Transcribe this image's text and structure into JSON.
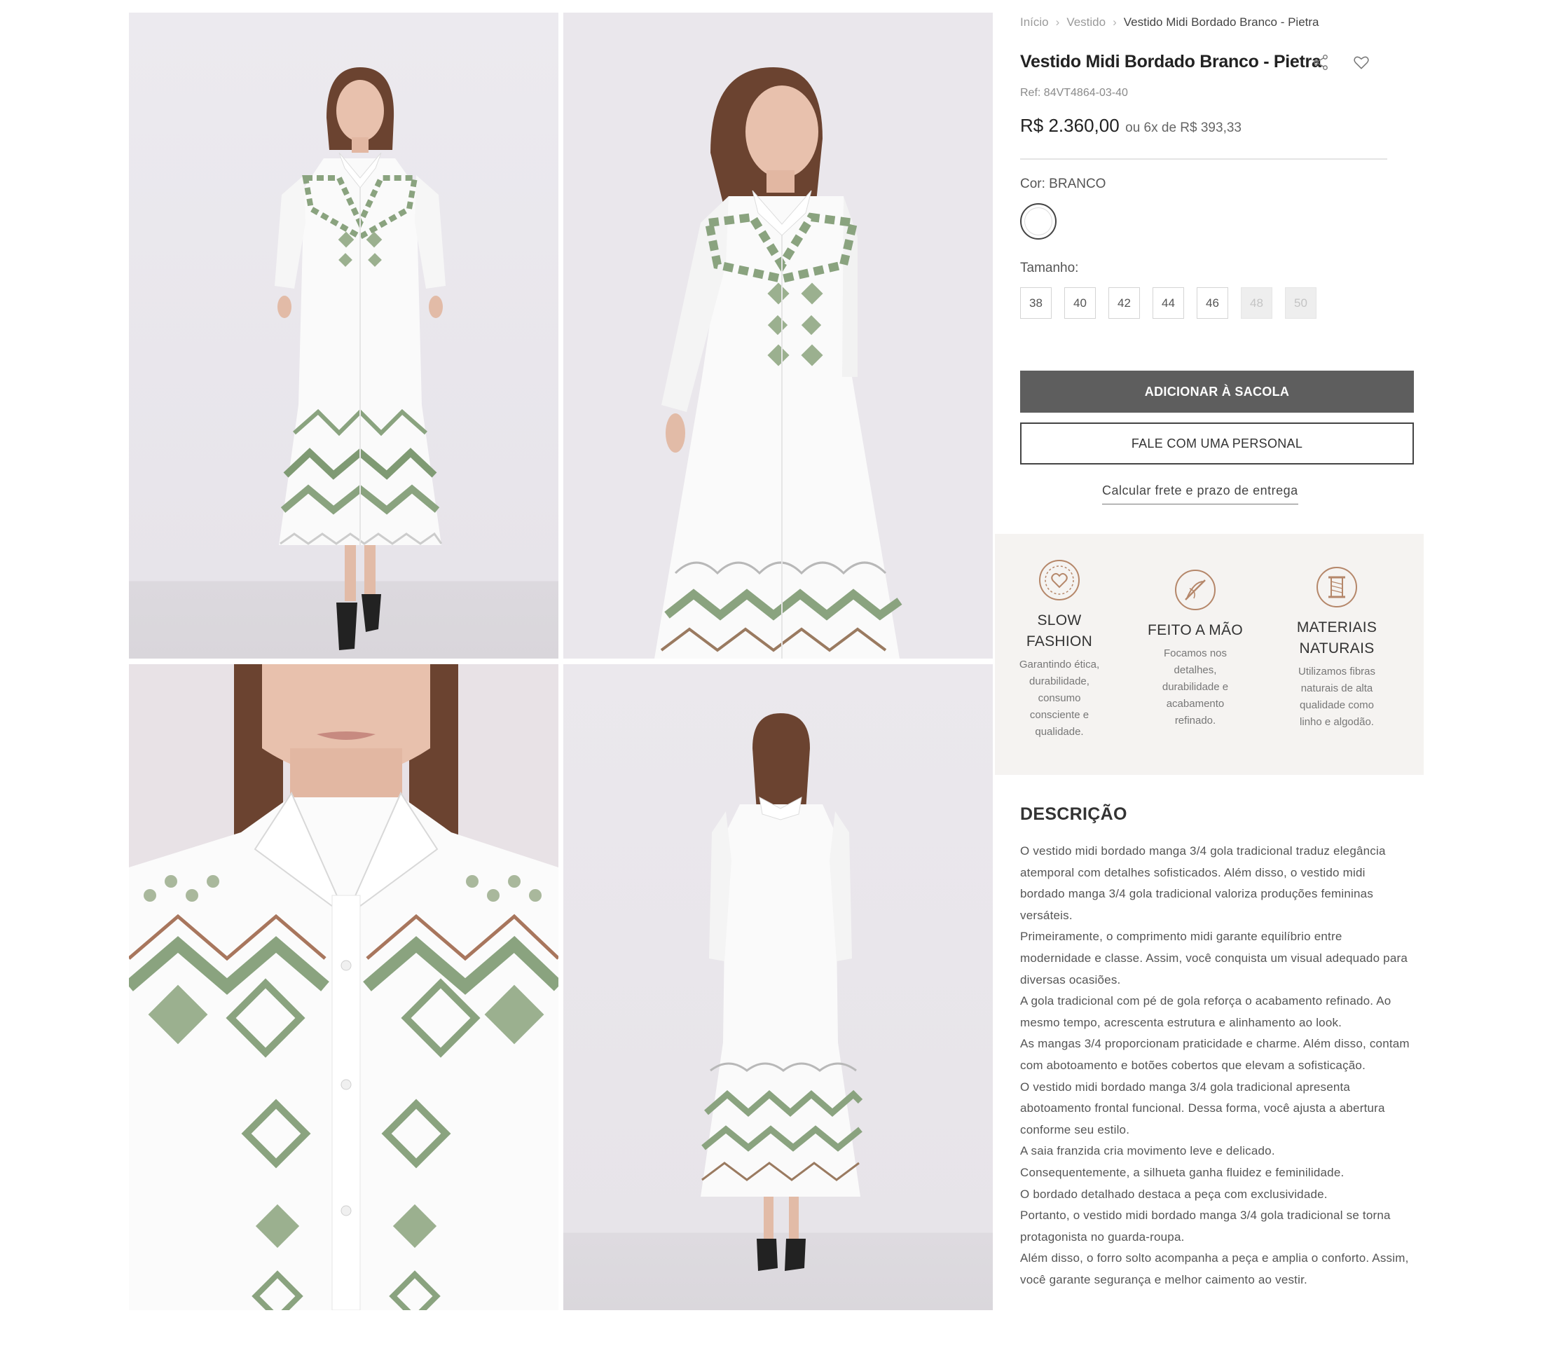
{
  "breadcrumb": {
    "home": "Início",
    "category": "Vestido",
    "current": "Vestido Midi Bordado Branco - Pietra"
  },
  "product": {
    "title": "Vestido Midi Bordado Branco - Pietra",
    "ref": "Ref: 84VT4864-03-40",
    "price": "R$ 2.360,00",
    "installments": "ou 6x de R$ 393,33",
    "color_label": "Cor: BRANCO",
    "color_swatch": "#ffffff",
    "size_label": "Tamanho:",
    "sizes": [
      {
        "label": "38",
        "available": true
      },
      {
        "label": "40",
        "available": true
      },
      {
        "label": "42",
        "available": true
      },
      {
        "label": "44",
        "available": true
      },
      {
        "label": "46",
        "available": true
      },
      {
        "label": "48",
        "available": false
      },
      {
        "label": "50",
        "available": false
      }
    ]
  },
  "actions": {
    "add_to_bag": "ADICIONAR À SACOLA",
    "talk_personal": "FALE COM UMA PERSONAL",
    "shipping": "Calcular frete e prazo de entrega",
    "share_icon": "share-icon",
    "wishlist_icon": "heart-icon"
  },
  "features": [
    {
      "name_line1": "SLOW",
      "name_line2": "FASHION",
      "desc": [
        "Garantindo ética,",
        "durabilidade,",
        "consumo",
        "consciente e",
        "qualidade."
      ],
      "icon": "heart-circle-icon"
    },
    {
      "name_line1": "FEITO A MÃO",
      "name_line2": "",
      "desc": [
        "Focamos nos",
        "detalhes,",
        "durabilidade e",
        "acabamento",
        "refinado."
      ],
      "icon": "needle-thread-icon"
    },
    {
      "name_line1": "MATERIAIS",
      "name_line2": "NATURAIS",
      "desc": [
        "Utilizamos fibras",
        "naturais de alta",
        "qualidade como",
        "linho e algodão."
      ],
      "icon": "spool-icon"
    }
  ],
  "description": {
    "title": "DESCRIÇÃO",
    "paragraphs": [
      "O vestido midi bordado manga 3/4 gola tradicional traduz elegância atemporal com detalhes sofisticados. Além disso, o vestido midi bordado manga 3/4 gola tradicional valoriza produções femininas versáteis.",
      "Primeiramente, o comprimento midi garante equilíbrio entre modernidade e classe. Assim, você conquista um visual adequado para diversas ocasiões.",
      "A gola tradicional com pé de gola reforça o acabamento refinado. Ao mesmo tempo, acrescenta estrutura e alinhamento ao look.",
      "As mangas 3/4 proporcionam praticidade e charme. Além disso, contam com abotoamento e botões cobertos que elevam a sofisticação.",
      "O vestido midi bordado manga 3/4 gola tradicional apresenta abotoamento frontal funcional. Dessa forma, você ajusta a abertura conforme seu estilo.",
      "A saia franzida cria movimento leve e delicado.",
      "Consequentemente, a silhueta ganha fluidez e feminilidade.",
      "O bordado detalhado destaca a peça com exclusividade.",
      "Portanto, o vestido midi bordado manga 3/4 gola tradicional se torna protagonista no guarda-roupa.",
      "Além disso, o forro solto acompanha a peça e amplia o conforto. Assim, você garante segurança e melhor caimento ao vestir."
    ]
  },
  "colors": {
    "primary_button": "#5e5e5e",
    "feature_bg": "#f5f3f1",
    "feature_icon": "#b5876a",
    "embroidery": "#8aa37f"
  },
  "gallery": {
    "images": [
      "front-view",
      "side-view",
      "detail-view",
      "back-view"
    ]
  }
}
